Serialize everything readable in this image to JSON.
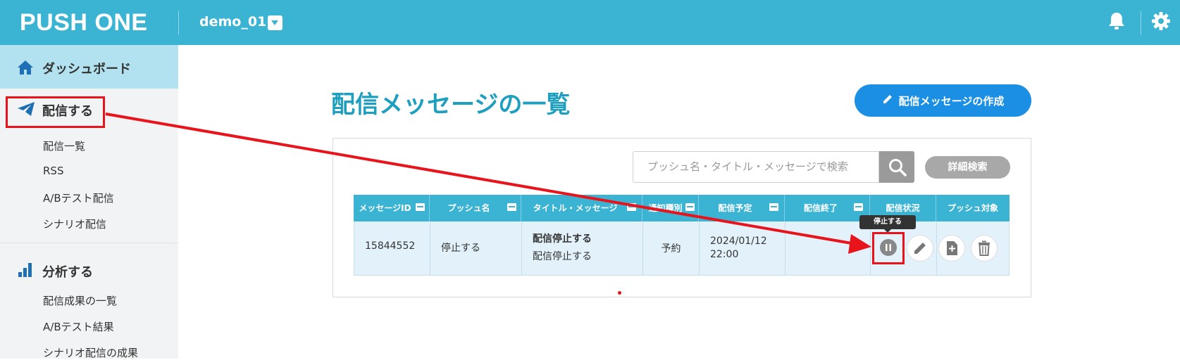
{
  "header": {
    "logo": "PUSH ONE",
    "project": "demo_01",
    "bg_color": "#3bb4d4"
  },
  "sidebar": {
    "dashboard": "ダッシュボード",
    "sections": [
      {
        "label": "配信する",
        "icon": "paper-plane-icon",
        "items": [
          "配信一覧",
          "RSS",
          "A/Bテスト配信",
          "シナリオ配信"
        ]
      },
      {
        "label": "分析する",
        "icon": "bar-chart-icon",
        "items": [
          "配信成果の一覧",
          "A/Bテスト結果",
          "シナリオ配信の成果"
        ]
      }
    ]
  },
  "main": {
    "title": "配信メッセージの一覧",
    "create_button": "配信メッセージの作成",
    "search_placeholder": "プッシュ名・タイトル・メッセージで検索",
    "detail_search": "詳細検索",
    "columns": [
      "メッセージID",
      "プッシュ名",
      "タイトル・メッセージ",
      "通知種別",
      "配信予定",
      "配信終了",
      "配信状況",
      "プッシュ対象"
    ],
    "rows": [
      {
        "id": "15844552",
        "push_name": "停止する",
        "title": "配信停止する",
        "message": "配信停止する",
        "type": "予約",
        "scheduled_date": "2024/01/12",
        "scheduled_time": "22:00",
        "end": "",
        "status": ""
      }
    ],
    "tooltip": "停止する"
  },
  "colors": {
    "accent": "#3bb4d4",
    "primary_button": "#1a8fe3",
    "annotation": "#e8131b"
  }
}
